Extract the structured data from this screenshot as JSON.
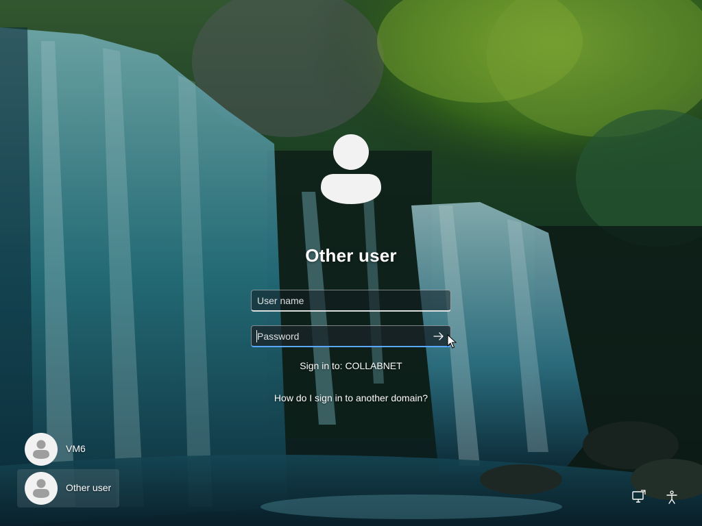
{
  "login": {
    "user_title": "Other user",
    "username_placeholder": "User name",
    "password_placeholder": "Password",
    "sign_in_to": "Sign in to: COLLABNET",
    "domain_help_link": "How do I sign in to another domain?"
  },
  "users": [
    {
      "name": "VM6",
      "selected": false
    },
    {
      "name": "Other user",
      "selected": true
    }
  ],
  "system_icons": {
    "network": "network-icon",
    "accessibility": "accessibility-icon"
  },
  "colors": {
    "focus_accent": "#5aa7ff",
    "text": "#ffffff",
    "avatar_fill": "#f2f2f2",
    "avatar_figure": "#9e9e9e"
  }
}
